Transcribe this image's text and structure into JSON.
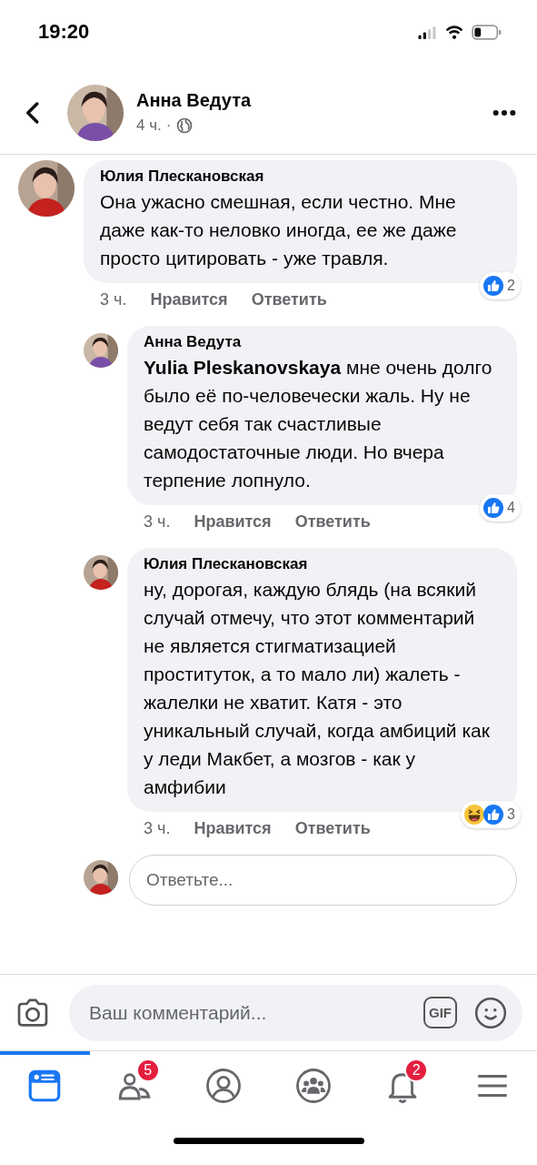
{
  "status_bar": {
    "time": "19:20"
  },
  "header": {
    "author": "Анна Ведута",
    "time": "4 ч.",
    "separator": "·"
  },
  "comments": [
    {
      "author": "Юлия Плескановская",
      "text": "Она ужасно смешная, если честно. Мне даже как-то неловко иногда, ее же даже просто цитировать - уже травля.",
      "time": "3 ч.",
      "like_label": "Нравится",
      "reply_label": "Ответить",
      "reactions": {
        "icons": [
          {
            "kind": "like"
          }
        ],
        "count": "2"
      },
      "children": [
        {
          "author": "Анна Ведута",
          "text": "**Yulia Pleskanovskaya** мне очень долго было её по-человечески жаль. Ну не ведут себя так счастливые самодостаточные люди. Но вчера терпение лопнуло.",
          "time": "3 ч.",
          "like_label": "Нравится",
          "reply_label": "Ответить",
          "reactions": {
            "icons": [
              {
                "kind": "like"
              }
            ],
            "count": "4"
          }
        },
        {
          "author": "Юлия Плескановская",
          "text": "ну, дорогая, каждую блядь (на всякий случай отмечу, что этот комментарий не является стигматизацией проституток, а то мало ли) жалеть - жалелки не хватит. Катя - это уникальный случай, когда амбиций как у леди Макбет, а мозгов - как у амфибии",
          "time": "3 ч.",
          "like_label": "Нравится",
          "reply_label": "Ответить",
          "reactions": {
            "icons": [
              {
                "kind": "haha"
              },
              {
                "kind": "like"
              }
            ],
            "count": "3"
          }
        }
      ]
    }
  ],
  "reply_field": {
    "placeholder": "Ответьте..."
  },
  "composer": {
    "placeholder": "Ваш комментарий...",
    "gif_label": "GIF"
  },
  "tab_bar": [
    {
      "kind": "feed",
      "selected": true
    },
    {
      "kind": "friends",
      "selected": false,
      "badge": "5"
    },
    {
      "kind": "profile",
      "selected": false
    },
    {
      "kind": "groups",
      "selected": false
    },
    {
      "kind": "notifications",
      "selected": false,
      "badge": "2"
    },
    {
      "kind": "menu",
      "selected": false
    }
  ]
}
